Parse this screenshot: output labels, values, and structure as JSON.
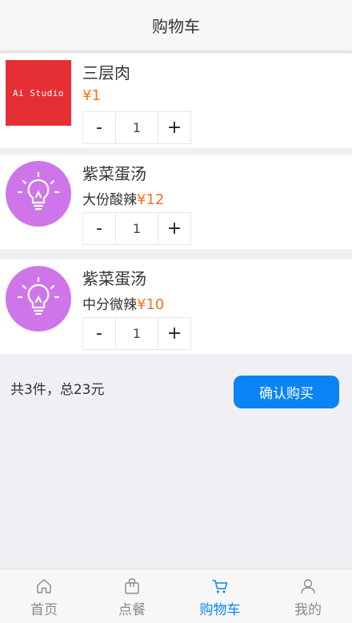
{
  "header": {
    "title": "购物车"
  },
  "cart": {
    "items": [
      {
        "name": "三层肉",
        "spec": "",
        "price": "¥1",
        "qty": "1",
        "thumb_type": "brand",
        "thumb_text": "Ai Studio"
      },
      {
        "name": "紫菜蛋汤",
        "spec": "大份酸辣",
        "price": "¥12",
        "qty": "1",
        "thumb_type": "bulb-icon"
      },
      {
        "name": "紫菜蛋汤",
        "spec": "中分微辣",
        "price": "¥10",
        "qty": "1",
        "thumb_type": "bulb-icon"
      }
    ],
    "minus_label": "-",
    "plus_label": "+"
  },
  "summary": {
    "text": "共3件，总23元"
  },
  "confirm_button": {
    "label": "确认购买"
  },
  "tabbar": {
    "tabs": [
      {
        "label": "首页",
        "icon": "home-icon",
        "active": false
      },
      {
        "label": "点餐",
        "icon": "bag-icon",
        "active": false
      },
      {
        "label": "购物车",
        "icon": "cart-icon",
        "active": true
      },
      {
        "label": "我的",
        "icon": "user-icon",
        "active": false
      }
    ]
  },
  "colors": {
    "accent": "#0a84f4",
    "price": "#f0741d",
    "brand_red": "#e52f35",
    "bulb_purple": "#cf75ea"
  }
}
